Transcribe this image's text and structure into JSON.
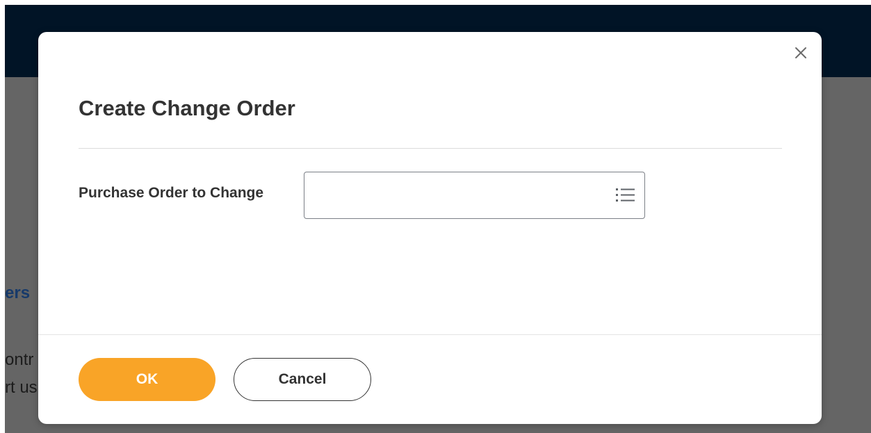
{
  "background": {
    "fragments": [
      "ers",
      "ontr",
      "rt us"
    ]
  },
  "dialog": {
    "title": "Create Change Order",
    "close_icon": "close-icon",
    "field": {
      "label": "Purchase Order to Change",
      "value": "",
      "placeholder": "",
      "prompt_icon": "list-prompt-icon"
    },
    "buttons": {
      "ok_label": "OK",
      "cancel_label": "Cancel"
    }
  },
  "colors": {
    "header": "#011426",
    "overlay": "#656565",
    "primary_button": "#f9a427",
    "text": "#333333"
  }
}
